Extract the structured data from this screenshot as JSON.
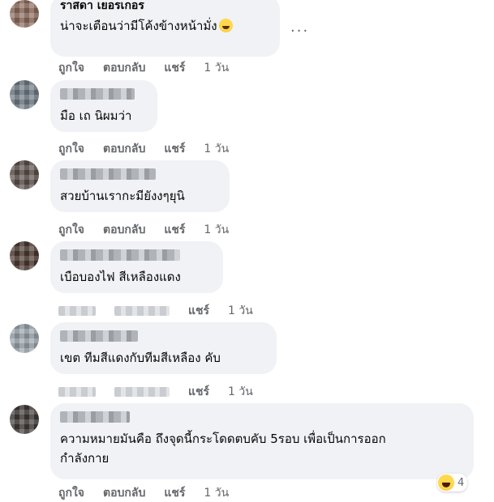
{
  "actions": {
    "like": "ถูกใจ",
    "reply": "ตอบกลับ",
    "share": "แชร์"
  },
  "comments": [
    {
      "author": "ราสิดา เยอรเกอร",
      "text": "น่าจะเตือนว่ามีโค้งข้างหน้ามั่ง",
      "emoji": "grinning-face",
      "time": "1 วัน"
    },
    {
      "text": "มือ เถ นิผมว่า",
      "time": "1 วัน"
    },
    {
      "text": "สวยบ้านเรากะมียังงๆยุนิ",
      "time": "1 วัน"
    },
    {
      "text": "เบือบองไฟ สีเหลืองแดง",
      "time": "1 วัน"
    },
    {
      "text": "เขต ทีมสีแดงกับทีมสีเหลือง คับ",
      "time": "1 วัน"
    },
    {
      "text_line1": "ความหมายมันคือ ถึงจุดนี้กระโดดตบคับ 5รอบ เพื่อเป็นการออก",
      "text_line2": "กำลังกาย",
      "time": "1 วัน",
      "reaction": {
        "icon": "haha-emoji",
        "count": "4"
      }
    }
  ],
  "more_options": "···"
}
